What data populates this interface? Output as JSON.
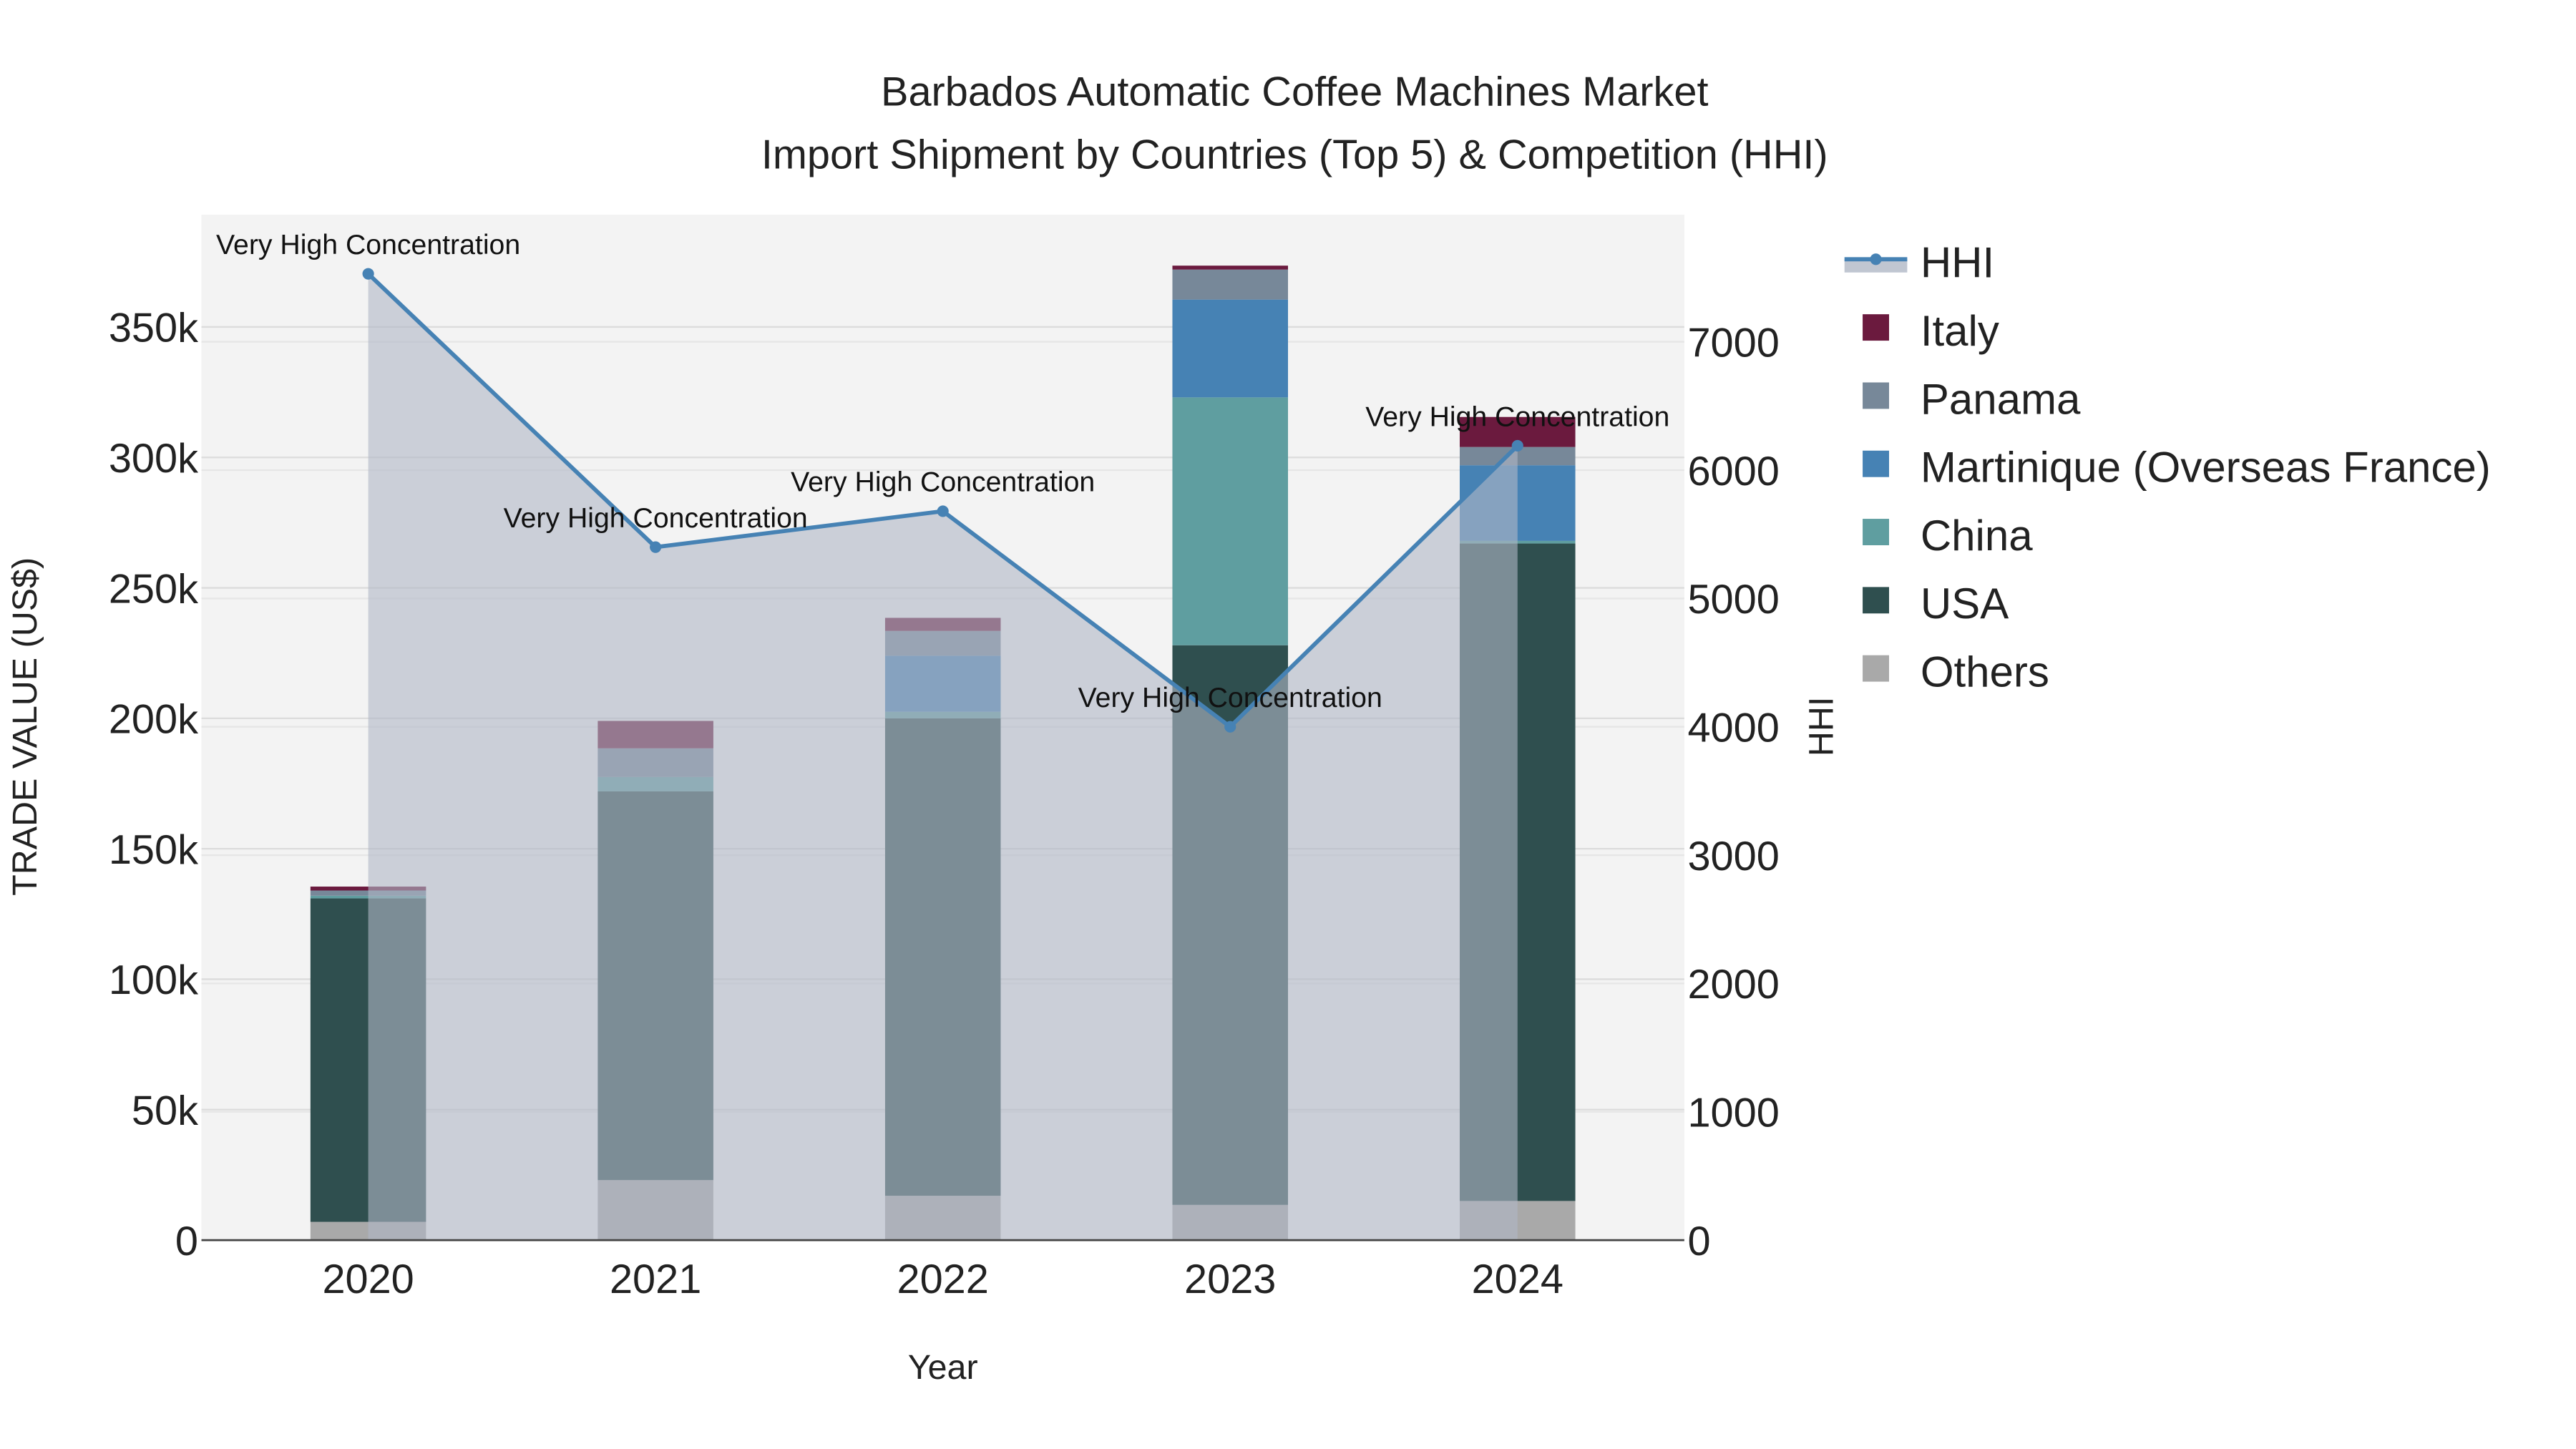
{
  "chart_data": {
    "type": "bar",
    "stacked": true,
    "title": "Barbados Automatic Coffee Machines Market",
    "subtitle": "Import Shipment by Countries (Top 5) & Competition (HHI)",
    "xlabel": "Year",
    "ylabel": "TRADE VALUE (US$)",
    "y2label": "HHI",
    "categories": [
      "2020",
      "2021",
      "2022",
      "2023",
      "2024"
    ],
    "ylim": [
      0,
      390000
    ],
    "yticks": [
      0,
      50000,
      100000,
      150000,
      200000,
      250000,
      300000,
      350000
    ],
    "ytick_labels": [
      "0",
      "50k",
      "100k",
      "150k",
      "200k",
      "250k",
      "300k",
      "350k"
    ],
    "y2lim": [
      0,
      8000
    ],
    "y2ticks": [
      0,
      1000,
      2000,
      3000,
      4000,
      5000,
      6000,
      7000
    ],
    "y2tick_labels": [
      "0",
      "1000",
      "2000",
      "3000",
      "4000",
      "5000",
      "6000",
      "7000"
    ],
    "series": [
      {
        "name": "Others",
        "color": "#a9a9a9",
        "values": [
          7000,
          23000,
          17000,
          13500,
          15000
        ]
      },
      {
        "name": "USA",
        "color": "#2f4f4f",
        "values": [
          124000,
          149000,
          183000,
          214500,
          252000
        ]
      },
      {
        "name": "China",
        "color": "#5f9ea0",
        "values": [
          1000,
          5500,
          2500,
          95000,
          1000
        ]
      },
      {
        "name": "Martinique (Overseas France)",
        "color": "#4682b4",
        "values": [
          0,
          0,
          21500,
          37500,
          29000
        ]
      },
      {
        "name": "Panama",
        "color": "#778899",
        "values": [
          2000,
          11000,
          9500,
          11500,
          7000
        ]
      },
      {
        "name": "Italy",
        "color": "#6b1a3e",
        "values": [
          1500,
          10500,
          5000,
          1500,
          11500
        ]
      }
    ],
    "hhi": {
      "name": "HHI",
      "color": "#4682b4",
      "values": [
        7530,
        5400,
        5680,
        4000,
        6190
      ],
      "annotations": [
        "Very High Concentration",
        "Very High Concentration",
        "Very High Concentration",
        "Very High Concentration",
        "Very High Concentration"
      ]
    },
    "legend_order": [
      "HHI",
      "Italy",
      "Panama",
      "Martinique (Overseas France)",
      "China",
      "USA",
      "Others"
    ],
    "legend_placement": "right",
    "grid": true
  }
}
